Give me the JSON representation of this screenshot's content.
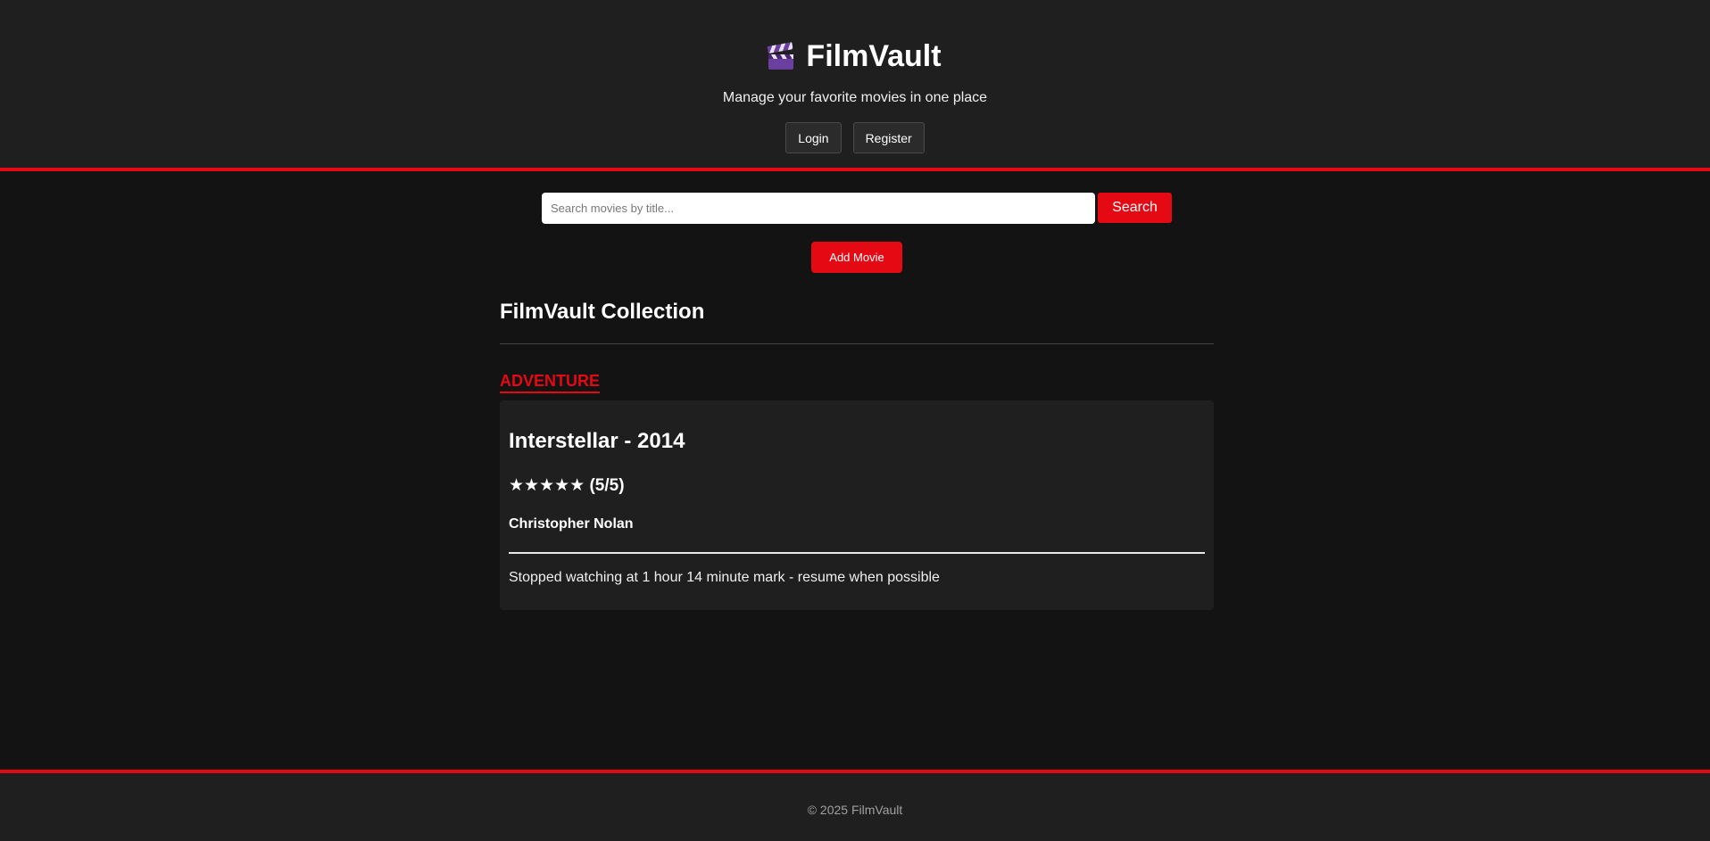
{
  "header": {
    "title": "FilmVault",
    "icon": "clapperboard-icon",
    "tagline": "Manage your favorite movies in one place",
    "login_label": "Login",
    "register_label": "Register"
  },
  "search": {
    "placeholder": "Search movies by title...",
    "value": "",
    "button_label": "Search"
  },
  "add_movie_label": "Add Movie",
  "collection": {
    "title": "FilmVault Collection",
    "genres": [
      {
        "name": "ADVENTURE",
        "movies": [
          {
            "title": "Interstellar - 2014",
            "stars": "★★★★★",
            "rating_text": "(5/5)",
            "rating": 5,
            "director": "Christopher Nolan",
            "notes": "Stopped watching at 1 hour 14 minute mark - resume when possible"
          }
        ]
      }
    ]
  },
  "footer": {
    "text": "© 2025 FilmVault"
  },
  "colors": {
    "accent": "#e50914",
    "background": "#131313",
    "surface": "#1f1f1f"
  }
}
